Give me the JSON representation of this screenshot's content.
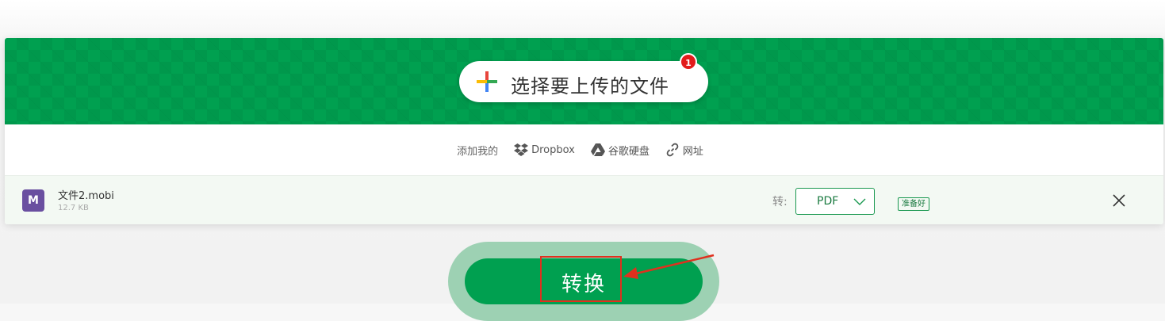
{
  "upload": {
    "choose_label": "选择要上传的文件",
    "badge_count": "1"
  },
  "sources": {
    "label": "添加我的",
    "dropbox": "Dropbox",
    "google_drive": "谷歌硬盘",
    "url": "网址"
  },
  "file": {
    "icon_letter": "M",
    "name": "文件2.mobi",
    "size": "12.7 KB",
    "to_label": "转:",
    "format": "PDF",
    "status": "准备好"
  },
  "convert": {
    "label": "转换"
  },
  "colors": {
    "brand_green": "#00a050",
    "badge_red": "#e21b1b",
    "annotation_red": "#e0301e",
    "file_icon_purple": "#6a4fa0"
  },
  "icons": [
    "plus-icon",
    "dropbox-icon",
    "google-drive-icon",
    "link-icon",
    "chevron-down-icon",
    "close-icon",
    "annotation-arrow"
  ]
}
